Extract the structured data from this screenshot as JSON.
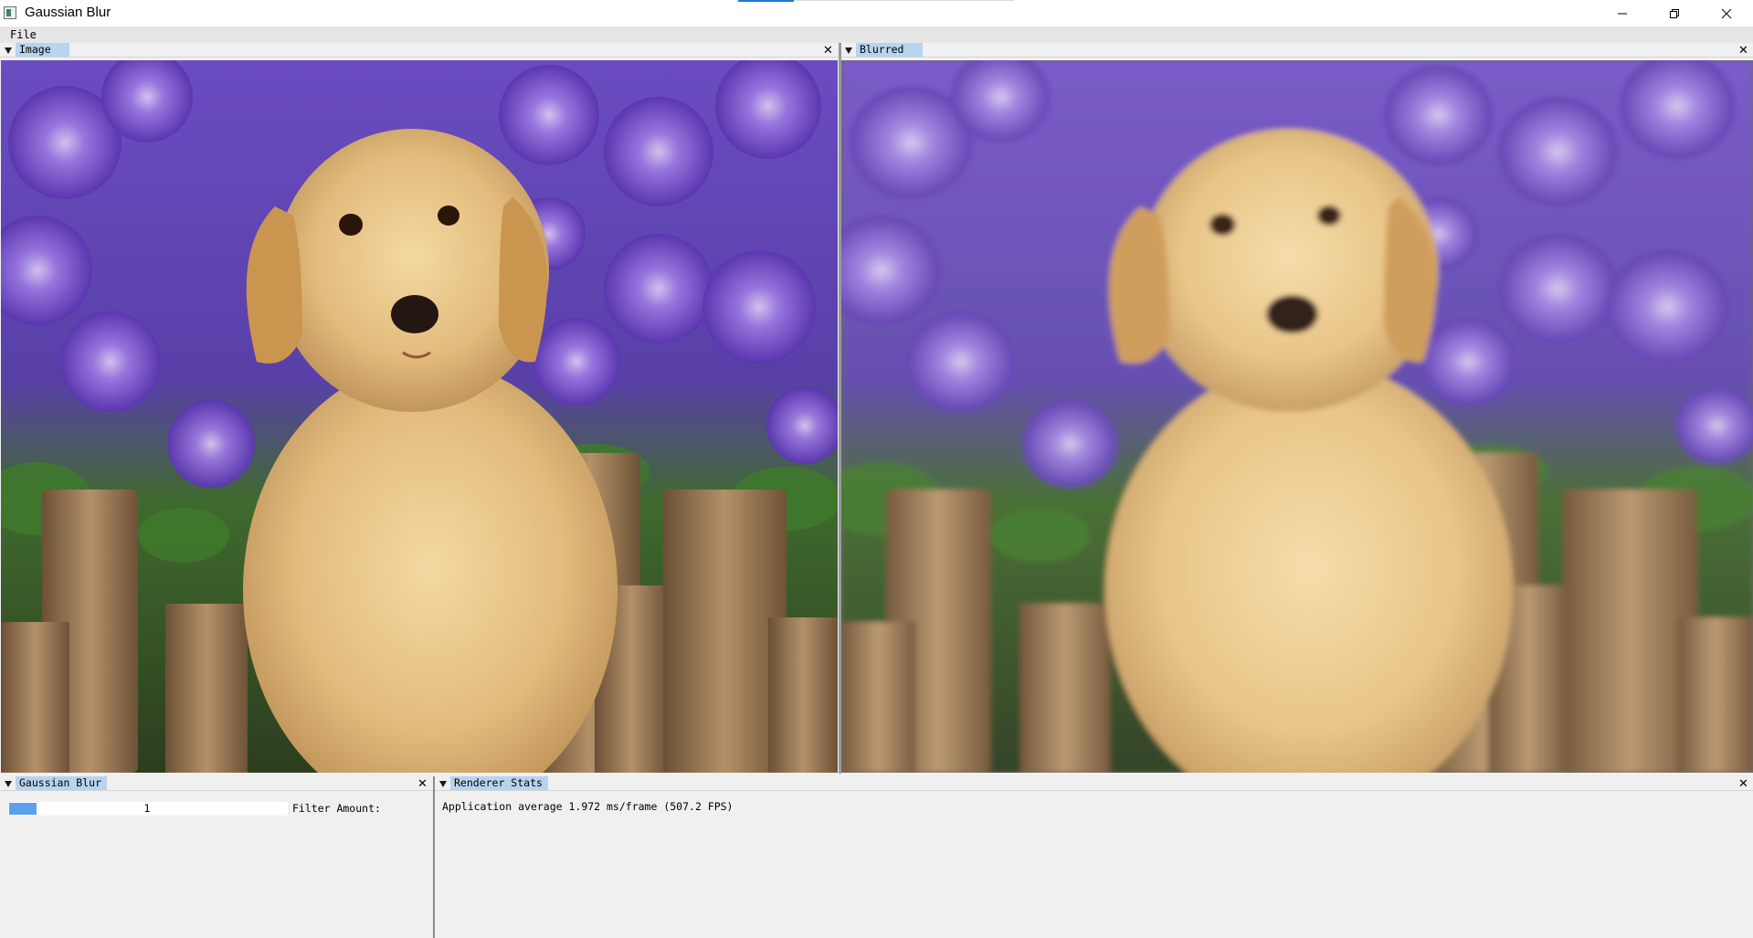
{
  "window": {
    "title": "Gaussian Blur",
    "controls": {
      "minimize": "minimize-icon",
      "restore": "restore-icon",
      "close": "close-icon"
    }
  },
  "menu": {
    "file": "File"
  },
  "panels": {
    "image": {
      "tab": "Image",
      "close": "✕"
    },
    "blurred": {
      "tab": "Blurred",
      "close": "✕"
    },
    "gaussian_blur": {
      "tab": "Gaussian Blur",
      "close": "✕",
      "slider": {
        "value": "1",
        "label": "Filter Amount:",
        "fill_fraction": 0.1
      }
    },
    "renderer_stats": {
      "tab": "Renderer Stats",
      "close": "✕",
      "text": "Application average 1.972 ms/frame (507.2 FPS)"
    }
  },
  "colors": {
    "tab_active": "#b7d4ef",
    "slider_fill": "#5aa0ea",
    "title_accent": "#1e7ad6"
  }
}
